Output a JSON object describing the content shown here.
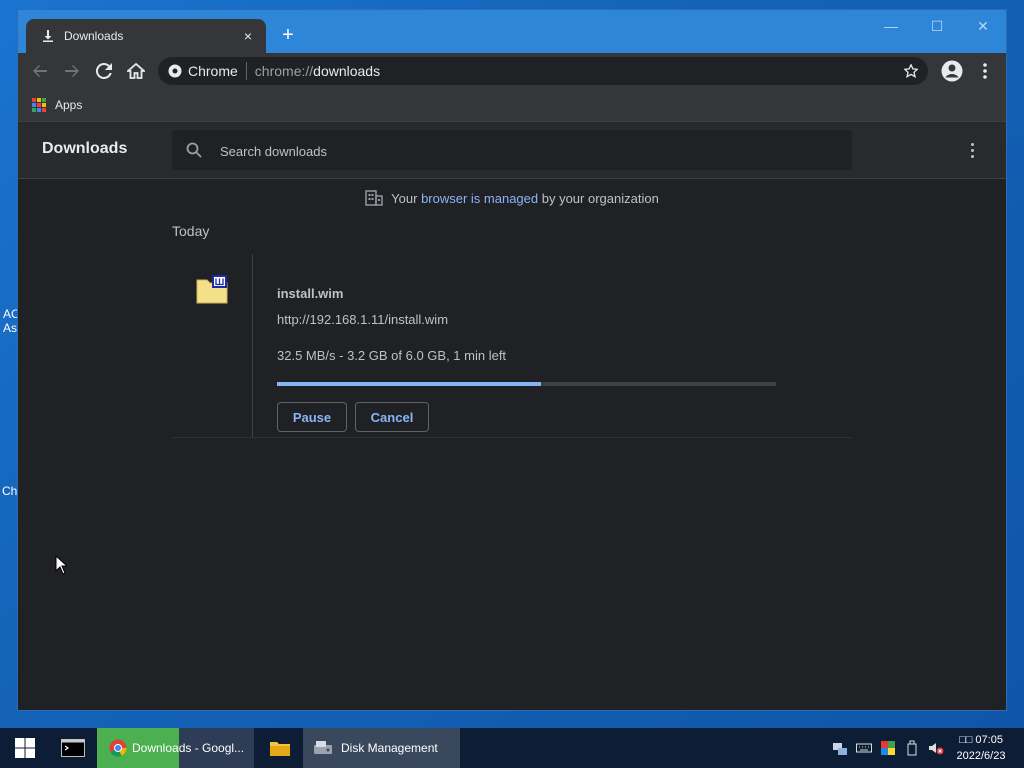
{
  "desktop": {
    "icon_label_1_line1": "AC",
    "icon_label_1_line2": "As",
    "icon_label_2": "Ch"
  },
  "browser": {
    "tab_title": "Downloads",
    "tab_close": "×",
    "new_tab": "+",
    "omnibox_chip": "Chrome",
    "url_scheme": "chrome://",
    "url_path": "downloads",
    "bookmarks_apps": "Apps",
    "window_controls": {
      "minimize": "—",
      "maximize": "☐",
      "close": "✕"
    }
  },
  "downloads": {
    "title": "Downloads",
    "search_placeholder": "Search downloads",
    "managed_prefix": "Your ",
    "managed_link": "browser is managed",
    "managed_suffix": " by your organization",
    "section_label": "Today",
    "item": {
      "filename": "install.wim",
      "url": "http://192.168.1.11/install.wim",
      "status": "32.5 MB/s - 3.2 GB of 6.0 GB, 1 min left",
      "progress_fraction": 0.53,
      "pause_label": "Pause",
      "cancel_label": "Cancel"
    }
  },
  "taskbar": {
    "chrome_label": "Downloads - Googl...",
    "disk_label": "Disk Management",
    "clock_time": "□□ 07:05",
    "clock_date": "2022/6/23"
  },
  "colors": {
    "accent": "#8ab4f8",
    "titlebar": "#2d86d8",
    "page_bg": "#202124",
    "toolbar": "#35363a"
  }
}
